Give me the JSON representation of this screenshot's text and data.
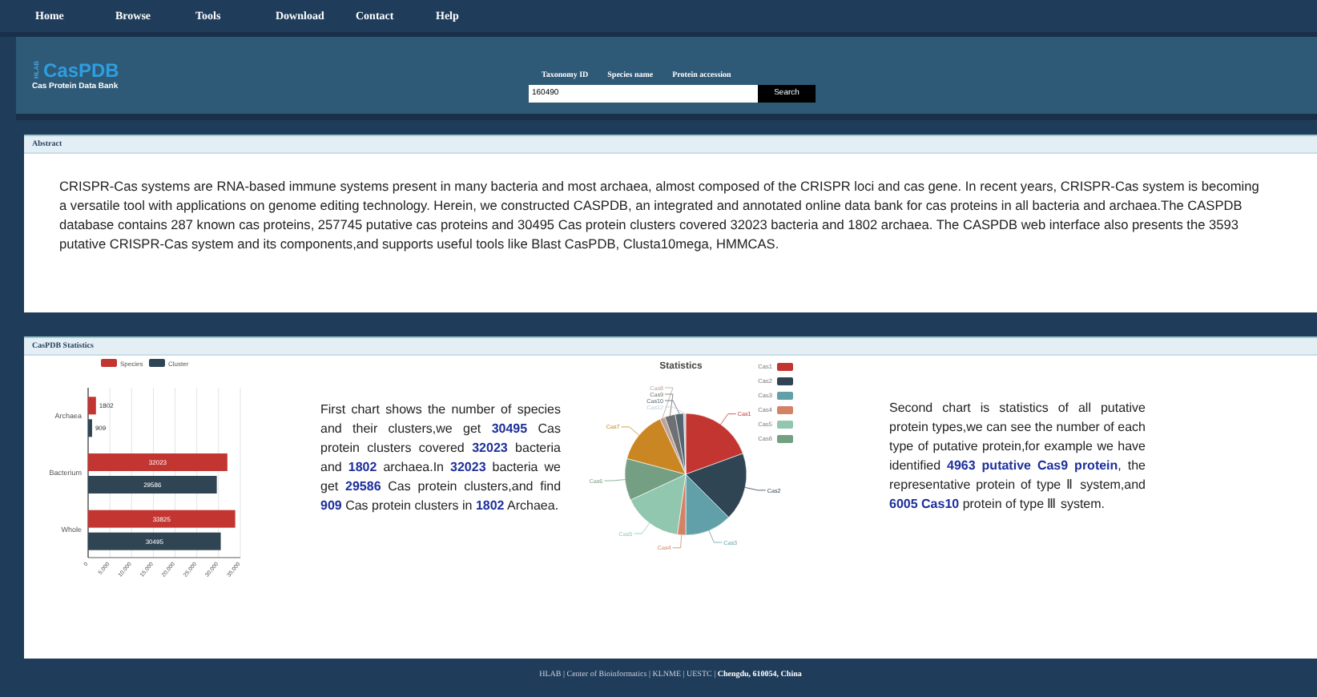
{
  "nav": {
    "items": [
      "Home",
      "Browse",
      "Tools",
      "Download",
      "Contact",
      "Help"
    ]
  },
  "header": {
    "logo_side": "HLAB",
    "logo": "CasPDB",
    "subtitle": "Cas Protein Data Bank",
    "search": {
      "types": [
        "Taxonomy ID",
        "Species name",
        "Protein accession"
      ],
      "value": "160490",
      "button": "Search"
    }
  },
  "abstract": {
    "title": "Abstract",
    "text": "CRISPR-Cas systems are RNA-based immune systems present in many bacteria and most archaea, almost composed of the CRISPR loci and cas gene. In recent years, CRISPR-Cas system is becoming a versatile tool with applications on genome editing technology. Herein, we constructed CASPDB, an integrated and annotated online data bank for cas proteins in all bacteria and archaea.The CASPDB database contains 287 known cas proteins, 257745 putative cas proteins and 30495 Cas protein clusters covered 32023 bacteria and 1802 archaea. The CASPDB web interface also presents the 3593 putative CRISPR-Cas system and its components,and supports useful tools like Blast CasPDB, Clusta10mega, HMMCAS."
  },
  "statistics": {
    "title": "CasPDB Statistics",
    "bar_chart": {
      "chart_data": {
        "type": "bar",
        "orientation": "horizontal",
        "categories": [
          "Archaea",
          "Bacterium",
          "Whole"
        ],
        "series": [
          {
            "name": "Species",
            "color": "#c23531",
            "values": [
              1802,
              32023,
              33825
            ]
          },
          {
            "name": "Cluster",
            "color": "#2f4554",
            "values": [
              909,
              29586,
              30495
            ]
          }
        ],
        "xlim": [
          0,
          35000
        ],
        "grid": true,
        "legend": true,
        "xticks": [
          {
            "value": 0,
            "label": "0"
          },
          {
            "value": 5000,
            "label": "5,000"
          },
          {
            "value": 10000,
            "label": "10,000"
          },
          {
            "value": 15000,
            "label": "15,000"
          },
          {
            "value": 20000,
            "label": "20,000"
          },
          {
            "value": 25000,
            "label": "25,000"
          },
          {
            "value": 30000,
            "label": "30,000"
          },
          {
            "value": 35000,
            "label": "35,000"
          }
        ],
        "data_labels": true
      }
    },
    "first_text": "First chart shows the number of species and their clusters,we get **30495** Cas protein clusters covered **32023** bacteria and **1802** archaea.In **32023** bacteria we get **29586** Cas protein clusters,and find **909** Cas protein clusters in **1802** Archaea.",
    "pie_chart": {
      "title": "Statistics",
      "legend": [
        {
          "label": "Cas1",
          "color": "#c23531"
        },
        {
          "label": "Cas2",
          "color": "#2f4554"
        },
        {
          "label": "Cas3",
          "color": "#61a0a8"
        },
        {
          "label": "Cas4",
          "color": "#d48265"
        },
        {
          "label": "Cas5",
          "color": "#91c7ae"
        },
        {
          "label": "Cas6",
          "color": "#749f83"
        }
      ],
      "slices": [
        {
          "label": "Cas1",
          "color": "#c23531"
        },
        {
          "label": "Cas2",
          "color": "#2f4554"
        },
        {
          "label": "Cas3",
          "color": "#61a0a8"
        },
        {
          "label": "Cas4",
          "color": "#d48265"
        },
        {
          "label": "Cas5",
          "color": "#91c7ae"
        },
        {
          "label": "Cas6",
          "color": "#749f83"
        },
        {
          "label": "Cas7",
          "color": "#ca8622"
        },
        {
          "label": "Cas8",
          "color": "#bda29a"
        },
        {
          "label": "Cas9",
          "color": "#6e7074"
        },
        {
          "label": "Cas10",
          "color": "#546570"
        },
        {
          "label": "Cas12",
          "color": "#c4ccd3"
        }
      ]
    },
    "second_text": "Second chart is statistics of all putative protein types,we can see the number of each type of putative protein,for example we have identified **4963 putative Cas9 protein**, the representative protein of type Ⅱ system,and **6005 Cas10** protein of type Ⅲ system."
  },
  "footer": {
    "text": "HLAB | Center of Bioinformatics | KLNME | UESTC | **Chengdu, 610054, China**"
  }
}
